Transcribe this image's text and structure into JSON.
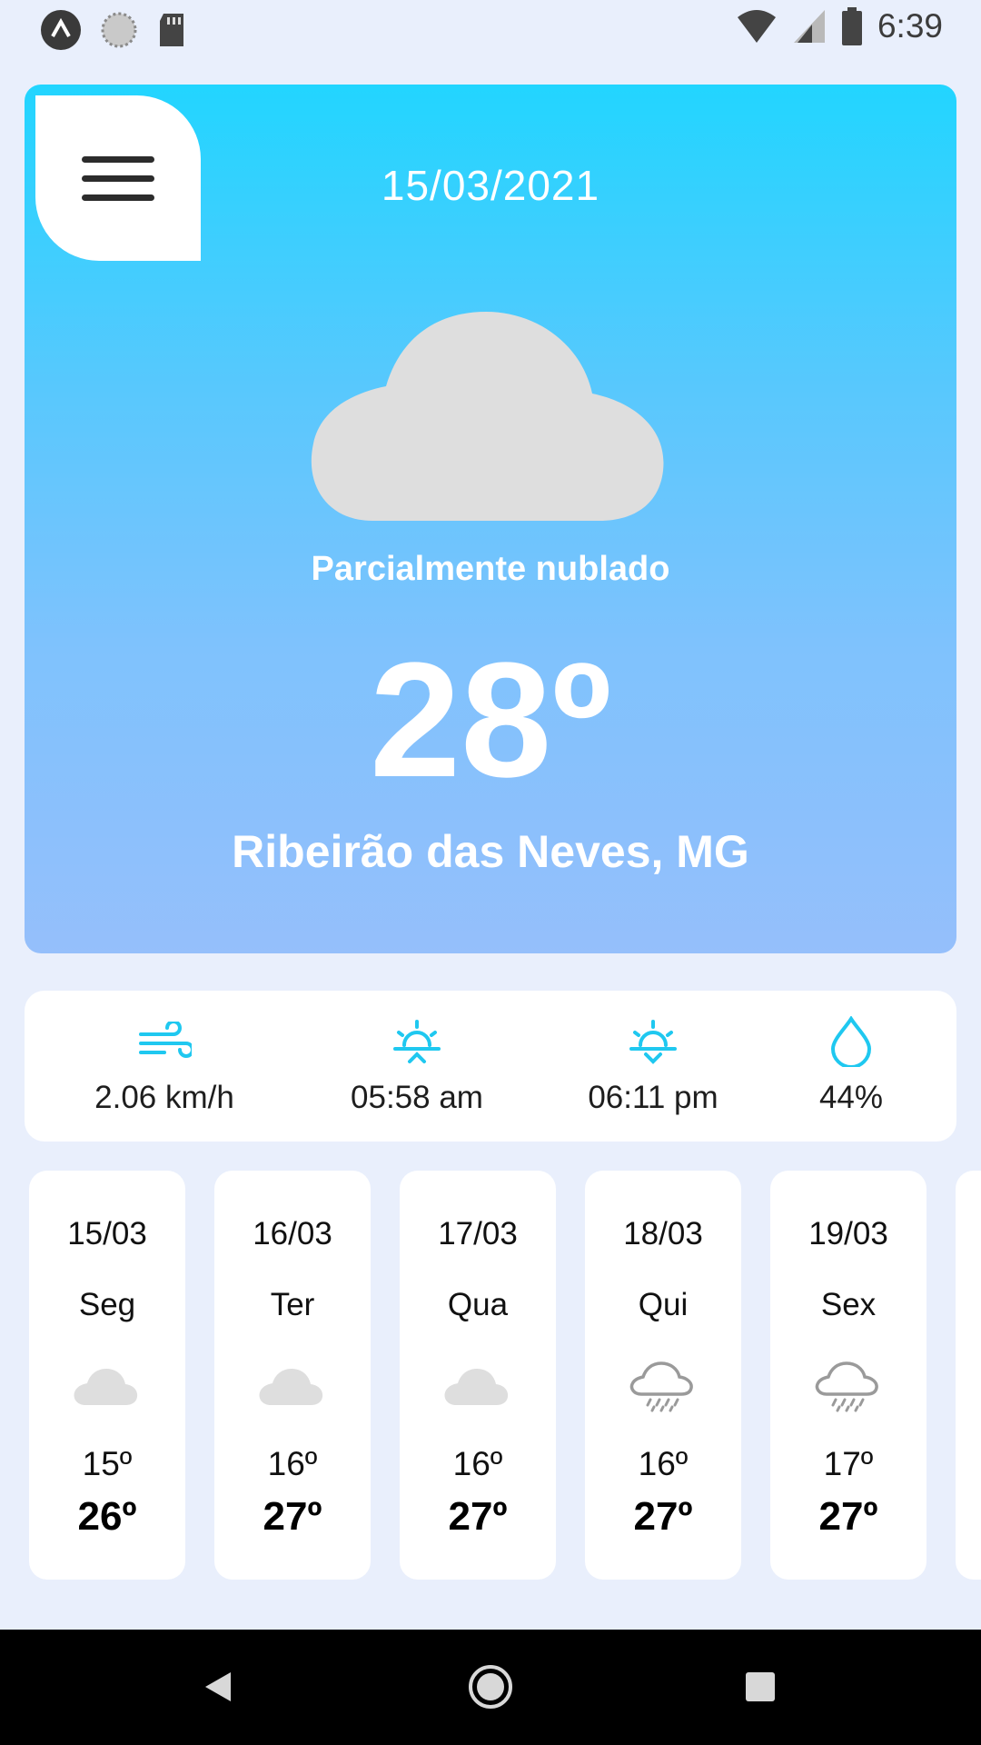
{
  "status_bar": {
    "time": "6:39",
    "left_icons": [
      "app-a-icon",
      "sync-circle-icon",
      "sd-card-icon"
    ],
    "right_icons": [
      "wifi-icon",
      "signal-icon",
      "battery-icon"
    ]
  },
  "hero": {
    "date": "15/03/2021",
    "condition_icon": "cloud-icon",
    "description": "Parcialmente nublado",
    "temperature": "28º",
    "city": "Ribeirão das Neves, MG"
  },
  "stats": [
    {
      "icon": "wind-icon",
      "value": "2.06 km/h"
    },
    {
      "icon": "sunrise-icon",
      "value": "05:58 am"
    },
    {
      "icon": "sunset-icon",
      "value": "06:11 pm"
    },
    {
      "icon": "humidity-drop-icon",
      "value": "44%"
    }
  ],
  "forecast": [
    {
      "date": "15/03",
      "day": "Seg",
      "icon": "cloud-icon",
      "min": "15º",
      "max": "26º"
    },
    {
      "date": "16/03",
      "day": "Ter",
      "icon": "cloud-icon",
      "min": "16º",
      "max": "27º"
    },
    {
      "date": "17/03",
      "day": "Qua",
      "icon": "cloud-icon",
      "min": "16º",
      "max": "27º"
    },
    {
      "date": "18/03",
      "day": "Qui",
      "icon": "rain-cloud-icon",
      "min": "16º",
      "max": "27º"
    },
    {
      "date": "19/03",
      "day": "Sex",
      "icon": "rain-cloud-icon",
      "min": "17º",
      "max": "27º"
    }
  ],
  "colors": {
    "background": "#e9effc",
    "hero_top": "#22d5ff",
    "hero_bottom": "#95bffb",
    "accent": "#1fc8f0",
    "cloud": "#dedede"
  }
}
